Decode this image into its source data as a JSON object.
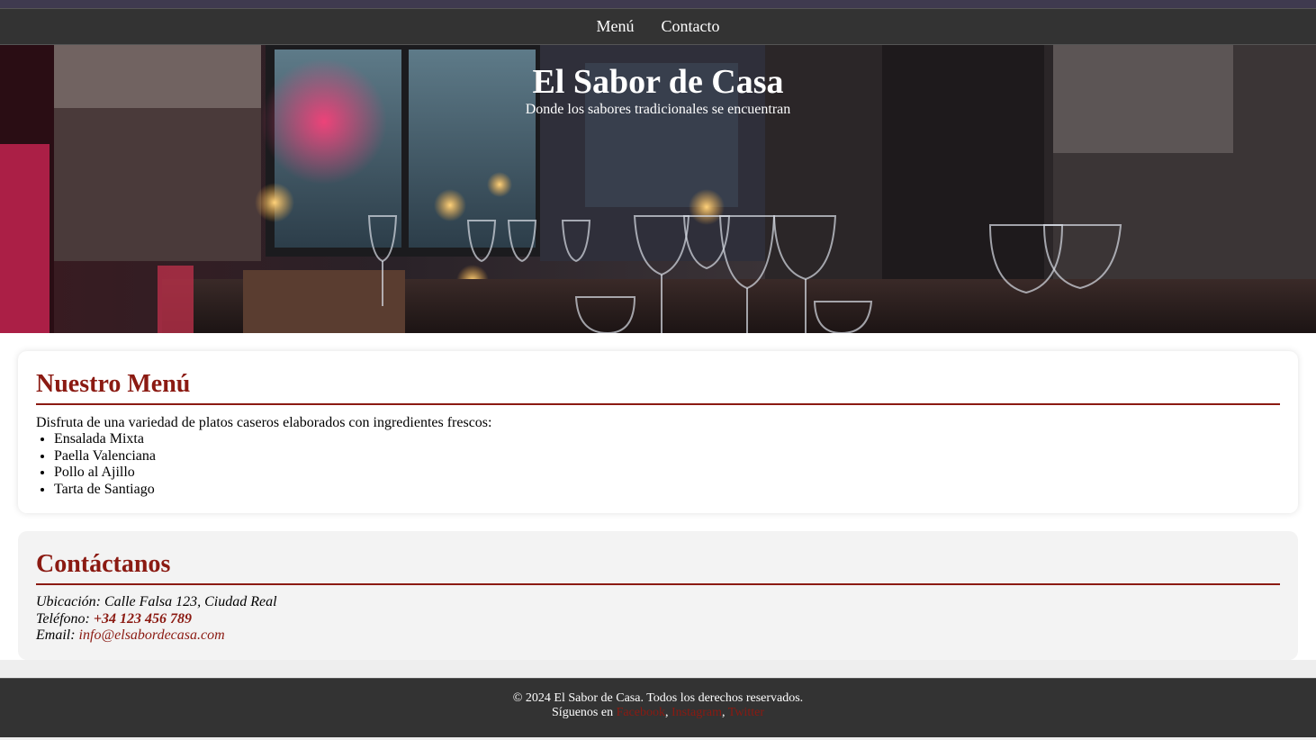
{
  "nav": {
    "items": [
      {
        "label": "Menú"
      },
      {
        "label": "Contacto"
      }
    ]
  },
  "hero": {
    "title": "El Sabor de Casa",
    "subtitle": "Donde los sabores tradicionales se encuentran",
    "image": "restaurant-interior-wine-glasses"
  },
  "menu_section": {
    "heading": "Nuestro Menú",
    "intro": "Disfruta de una variedad de platos caseros elaborados con ingredientes frescos:",
    "dishes": [
      "Ensalada Mixta",
      "Paella Valenciana",
      "Pollo al Ajillo",
      "Tarta de Santiago"
    ]
  },
  "contact_section": {
    "heading": "Contáctanos",
    "location_label": "Ubicación:",
    "location": "Calle Falsa 123, Ciudad Real",
    "phone_label": "Teléfono:",
    "phone": "+34 123 456 789",
    "email_label": "Email:",
    "email": "info@elsabordecasa.com"
  },
  "footer": {
    "copyright": "© 2024 El Sabor de Casa. Todos los derechos reservados.",
    "follow_label": "Síguenos en",
    "social": [
      "Facebook",
      "Instagram",
      "Twitter"
    ],
    "separator": ","
  },
  "colors": {
    "accent": "#8b1a12",
    "nav_bg": "#333333",
    "top_strip": "#3f3a4f"
  }
}
